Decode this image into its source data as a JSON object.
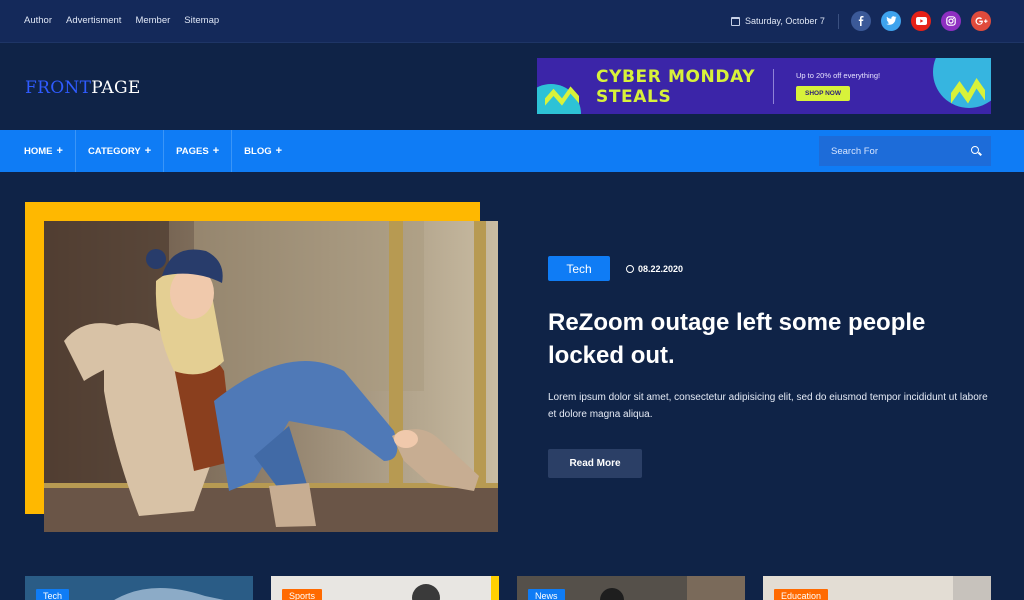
{
  "top_links": [
    "Author",
    "Advertisment",
    "Member",
    "Sitemap"
  ],
  "date": "Saturday, October 7",
  "social": [
    {
      "name": "facebook-icon",
      "glyph": "f",
      "color": "#3b5998"
    },
    {
      "name": "twitter-icon",
      "glyph": "t",
      "color": "#3ea3ee"
    },
    {
      "name": "youtube-icon",
      "glyph": "▶",
      "color": "#e62117"
    },
    {
      "name": "instagram-icon",
      "glyph": "◎",
      "color": "#8e2fc1"
    },
    {
      "name": "google-plus-icon",
      "glyph": "G+",
      "color": "#e04b3c"
    }
  ],
  "logo": {
    "part1": "FRONT",
    "part2": "PAGE"
  },
  "banner": {
    "line1": "CYBER MONDAY",
    "line2": "STEALS",
    "offer": "Up to 20% off everything!",
    "cta": "SHOP NOW"
  },
  "nav": {
    "items": [
      "HOME",
      "CATEGORY",
      "PAGES",
      "BLOG"
    ],
    "search_placeholder": "Search For"
  },
  "hero": {
    "tag": "Tech",
    "date": "08.22.2020",
    "title": "ReZoom outage left some people locked out.",
    "excerpt": "Lorem ipsum dolor sit amet, consectetur adipisicing elit, sed do eiusmod tempor incididunt ut labore et dolore magna aliqua.",
    "read_more": "Read More"
  },
  "cards": [
    {
      "tag": "Tech",
      "tag_color": "#0f7cf5"
    },
    {
      "tag": "Sports",
      "tag_color": "#ff6a00"
    },
    {
      "tag": "News",
      "tag_color": "#0f7cf5"
    },
    {
      "tag": "Education",
      "tag_color": "#ff6a00"
    }
  ],
  "colors": {
    "accent": "#0f7cf5",
    "frame": "#ffb800",
    "background": "#0f2347"
  }
}
